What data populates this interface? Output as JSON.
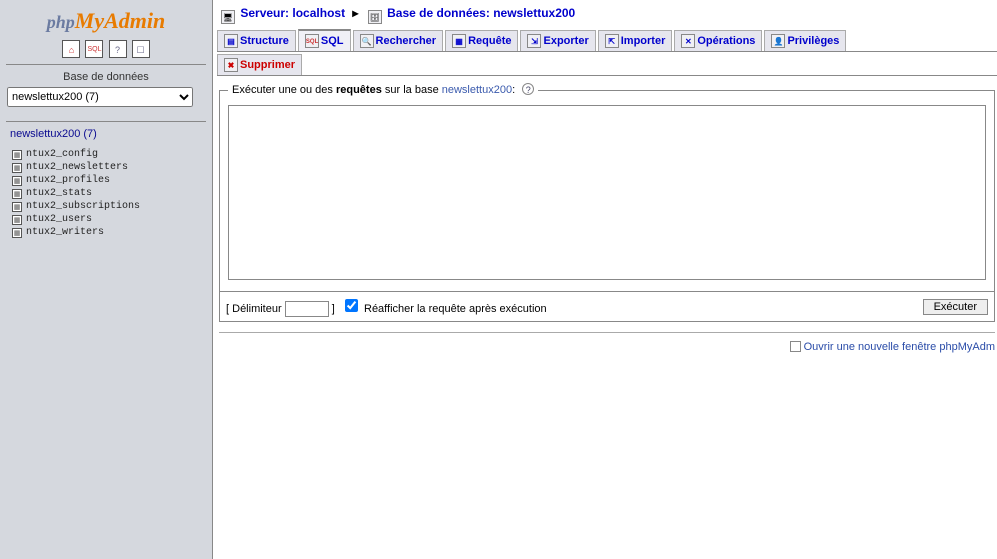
{
  "logo": {
    "part1": "php",
    "part2": "MyAdmin"
  },
  "sidebar": {
    "label": "Base de données",
    "selected_db": "newslettux200 (7)",
    "db_title": "newslettux200 (7)",
    "tables": [
      "ntux2_config",
      "ntux2_newsletters",
      "ntux2_profiles",
      "ntux2_stats",
      "ntux2_subscriptions",
      "ntux2_users",
      "ntux2_writers"
    ]
  },
  "crumb": {
    "server_label": "Serveur:",
    "server_value": "localhost",
    "db_label": "Base de données:",
    "db_value": "newslettux200"
  },
  "tabs": [
    {
      "label": "Structure",
      "icon": "structure"
    },
    {
      "label": "SQL",
      "icon": "sql",
      "active": true
    },
    {
      "label": "Rechercher",
      "icon": "search"
    },
    {
      "label": "Requête",
      "icon": "query"
    },
    {
      "label": "Exporter",
      "icon": "export"
    },
    {
      "label": "Importer",
      "icon": "import"
    },
    {
      "label": "Opérations",
      "icon": "ops"
    },
    {
      "label": "Privilèges",
      "icon": "priv"
    }
  ],
  "tabs2": [
    {
      "label": "Supprimer",
      "icon": "drop",
      "danger": true
    }
  ],
  "fieldset": {
    "legend_prefix": "Exécuter une ou des ",
    "legend_bold": "requêtes",
    "legend_suffix": " sur la base ",
    "legend_db": "newslettux200",
    "legend_after": ": "
  },
  "bottom": {
    "delimiter_label": "Délimiteur",
    "delimiter_value": "",
    "redisplay_label": "Réafficher la requête après exécution",
    "execute_label": "Exécuter"
  },
  "footer": {
    "new_window": "Ouvrir une nouvelle fenêtre phpMyAdm"
  }
}
